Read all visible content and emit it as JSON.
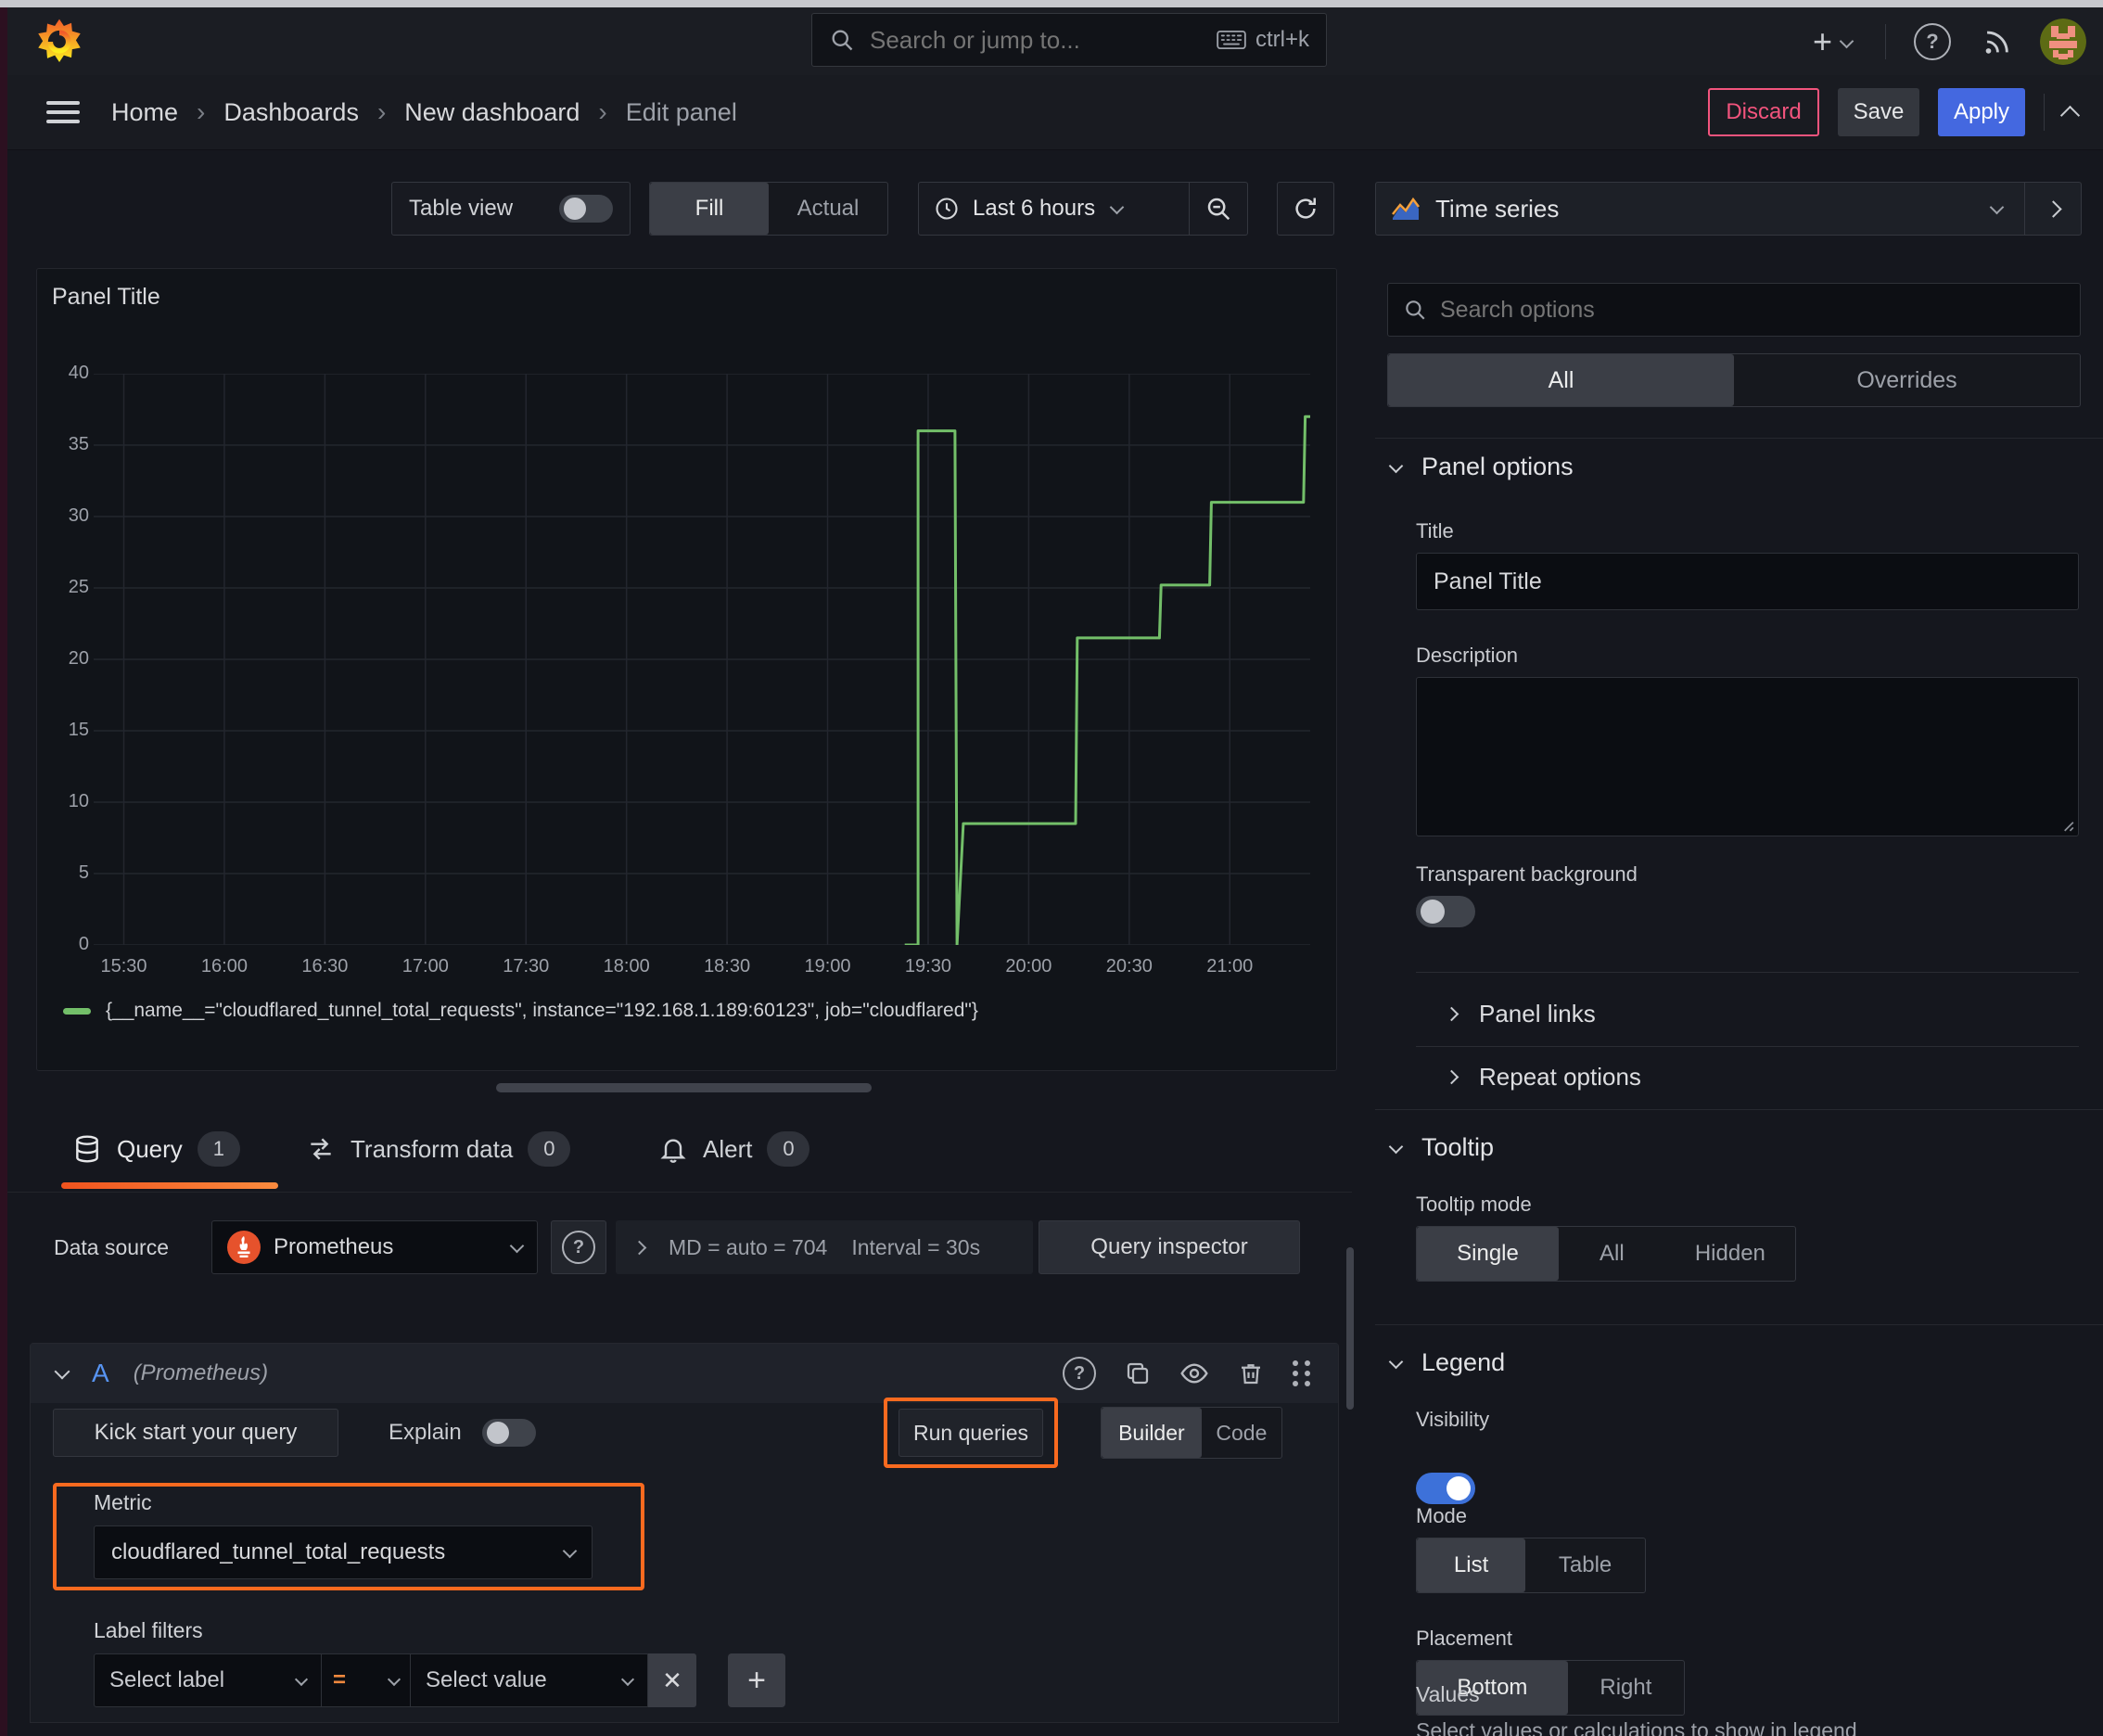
{
  "topbar": {
    "search_placeholder": "Search or jump to...",
    "shortcut": "ctrl+k"
  },
  "breadcrumb": {
    "items": [
      "Home",
      "Dashboards",
      "New dashboard",
      "Edit panel"
    ],
    "separator": "›"
  },
  "actions": {
    "discard": "Discard",
    "save": "Save",
    "apply": "Apply"
  },
  "toolbar": {
    "table_view": "Table view",
    "fill": "Fill",
    "actual": "Actual",
    "time_range": "Last 6 hours"
  },
  "viz_picker": {
    "label": "Time series"
  },
  "options_panel": {
    "search_placeholder": "Search options",
    "tab_all": "All",
    "tab_overrides": "Overrides",
    "panel_options": {
      "header": "Panel options",
      "title_label": "Title",
      "title_value": "Panel Title",
      "description_label": "Description",
      "transparent_label": "Transparent background",
      "panel_links": "Panel links",
      "repeat_options": "Repeat options"
    },
    "tooltip": {
      "header": "Tooltip",
      "mode_label": "Tooltip mode",
      "modes": [
        "Single",
        "All",
        "Hidden"
      ]
    },
    "legend": {
      "header": "Legend",
      "visibility_label": "Visibility",
      "mode_label": "Mode",
      "modes": [
        "List",
        "Table"
      ],
      "placement_label": "Placement",
      "placements": [
        "Bottom",
        "Right"
      ],
      "values_label": "Values",
      "values_desc": "Select values or calculations to show in legend"
    }
  },
  "panel": {
    "title": "Panel Title"
  },
  "tabs": {
    "query": "Query",
    "query_count": "1",
    "transform": "Transform data",
    "transform_count": "0",
    "alert": "Alert",
    "alert_count": "0"
  },
  "datasource_row": {
    "label": "Data source",
    "value": "Prometheus",
    "stats_md": "MD = auto = 704",
    "stats_interval": "Interval = 30s",
    "inspector": "Query inspector"
  },
  "query": {
    "ref_id": "A",
    "ds_hint": "(Prometheus)",
    "kick_start": "Kick start your query",
    "explain": "Explain",
    "run_queries": "Run queries",
    "builder": "Builder",
    "code": "Code",
    "metric_label": "Metric",
    "metric_value": "cloudflared_tunnel_total_requests",
    "label_filters": "Label filters",
    "select_label": "Select label",
    "operator": "=",
    "select_value": "Select value"
  },
  "chart_data": {
    "type": "line",
    "title": "Panel Title",
    "line_color": "#73bf69",
    "grid": true,
    "legend_position": "bottom",
    "ylim": [
      0,
      40
    ],
    "y_ticks": [
      0,
      5,
      10,
      15,
      20,
      25,
      30,
      35,
      40
    ],
    "x_domain_minutes": [
      921,
      1284
    ],
    "x_tick_minutes": [
      930,
      960,
      990,
      1020,
      1050,
      1080,
      1110,
      1140,
      1170,
      1200,
      1230,
      1260
    ],
    "x_ticks": [
      "15:30",
      "16:00",
      "16:30",
      "17:00",
      "17:30",
      "18:00",
      "18:30",
      "19:00",
      "19:30",
      "20:00",
      "20:30",
      "21:00"
    ],
    "series": [
      {
        "name": "{__name__=\"cloudflared_tunnel_total_requests\", instance=\"192.168.1.189:60123\", job=\"cloudflared\"}",
        "color": "#73bf69",
        "points_min_val": [
          [
            1163,
            0
          ],
          [
            1167,
            0
          ],
          [
            1167,
            36
          ],
          [
            1178,
            36
          ],
          [
            1178.6,
            0
          ],
          [
            1180.5,
            8.5
          ],
          [
            1214,
            8.5
          ],
          [
            1214.5,
            21.5
          ],
          [
            1239,
            21.5
          ],
          [
            1239.5,
            25.2
          ],
          [
            1254,
            25.2
          ],
          [
            1254.5,
            31
          ],
          [
            1282,
            31
          ],
          [
            1282.5,
            37
          ],
          [
            1284,
            37
          ]
        ]
      }
    ]
  }
}
